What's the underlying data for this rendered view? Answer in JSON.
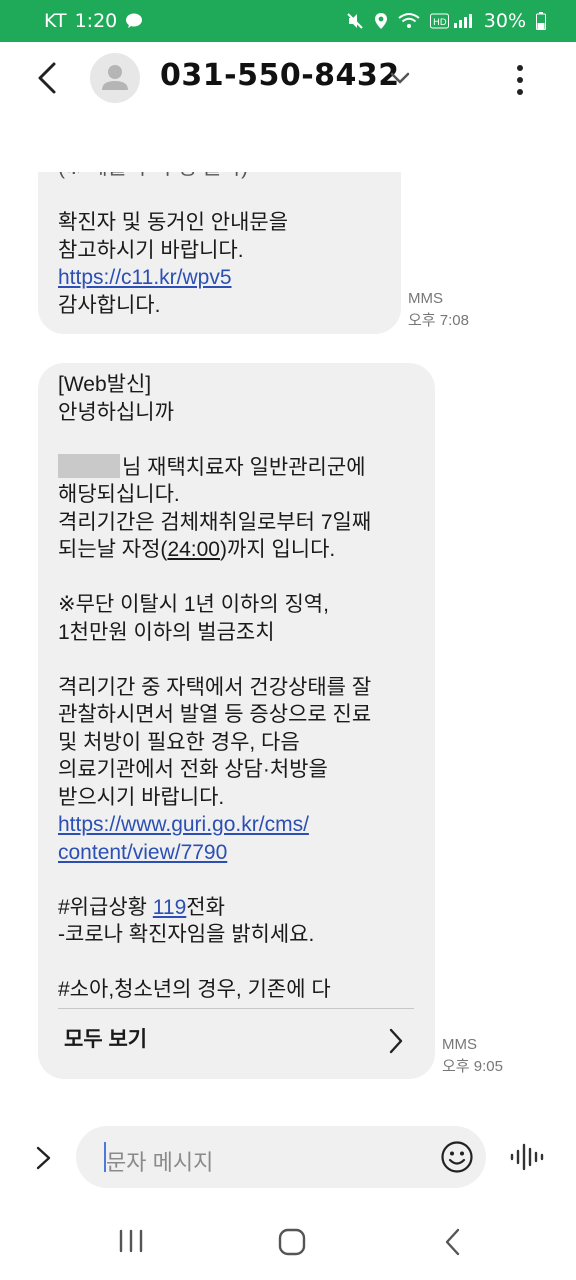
{
  "status_bar": {
    "carrier": "KT",
    "time": "1:20",
    "battery": "30%"
  },
  "header": {
    "contact": "031-550-8432"
  },
  "messages": [
    {
      "lines": [
        "(※ 제출 후 수정 불가)",
        "",
        "확진자 및 동거인 안내문을",
        "참고하시기 바랍니다.",
        "https://c11.kr/wpv5",
        "감사합니다."
      ],
      "type": "MMS",
      "time": "오후 7:08"
    },
    {
      "lines": [
        "[Web발신]",
        "안녕하십니까",
        "",
        "님 재택치료자 일반관리군에",
        "해당되십니다.",
        "격리기간은 검체채취일로부터 7일째",
        "되는날 자정(24:00)까지 입니다.",
        "",
        "※무단 이탈시 1년 이하의 징역,",
        "1천만원 이하의 벌금조치",
        "",
        "격리기간 중 자택에서 건강상태를 잘",
        "관찰하시면서 발열 등 증상으로 진료",
        "및 처방이 필요한 경우, 다음",
        "의료기관에서 전화 상담·처방을",
        "받으시기 바랍니다.",
        "https://www.guri.go.kr/cms/",
        "content/view/7790",
        "",
        "#위급상황 119전화",
        "-코로나 확진자임을 밝히세요.",
        "",
        "#소아,청소년의 경우, 기존에 다"
      ],
      "view_all": "모두 보기",
      "type": "MMS",
      "time": "오후 9:05"
    }
  ],
  "input": {
    "placeholder": "문자 메시지"
  },
  "colors": {
    "status_bar": "#1faa59",
    "bubble": "#f0f0f0",
    "link": "#2b4fb3"
  },
  "icons": [
    "back-arrow-icon",
    "contact-avatar-icon",
    "chevron-down-icon",
    "more-options-icon",
    "chevron-right-icon",
    "expand-icon",
    "emoji-icon",
    "voice-input-icon",
    "recent-apps-icon",
    "home-icon",
    "nav-back-icon"
  ]
}
